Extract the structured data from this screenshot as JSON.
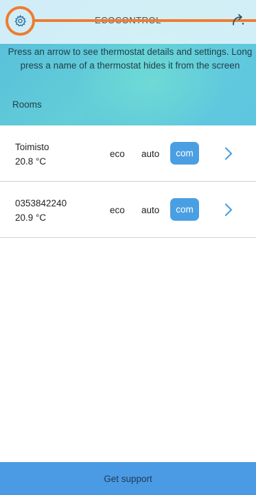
{
  "app": {
    "title": "ECOCONTROL"
  },
  "header": {
    "instructions": "Press an arrow to see thermostat details and settings. Long press a name of a thermostat hides it from the screen",
    "rooms_label": "Rooms"
  },
  "icons": {
    "settings": "gear-icon",
    "refresh": "refresh-icon",
    "details": "chevron-right-icon"
  },
  "colors": {
    "accent": "#4a9fe3",
    "highlight": "#ee7d2c",
    "footer": "#4a9be3"
  },
  "rooms": [
    {
      "name": "Toimisto",
      "temperature": "20.8 °C",
      "modes": [
        "eco",
        "auto",
        "com"
      ],
      "active_mode": "com"
    },
    {
      "name": "0353842240",
      "temperature": "20.9 °C",
      "modes": [
        "eco",
        "auto",
        "com"
      ],
      "active_mode": "com"
    }
  ],
  "footer": {
    "support_label": "Get support"
  }
}
